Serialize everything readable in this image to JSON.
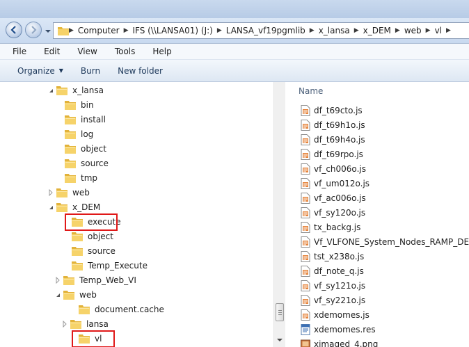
{
  "window": {
    "address": {
      "crumbs": [
        "Computer",
        "IFS (\\\\LANSA01) (J:)",
        "LANSA_vf19pgmlib",
        "x_lansa",
        "x_DEM",
        "web",
        "vl"
      ]
    }
  },
  "menu": {
    "items": [
      "File",
      "Edit",
      "View",
      "Tools",
      "Help"
    ]
  },
  "commands": {
    "organize": "Organize",
    "burn": "Burn",
    "new_folder": "New folder"
  },
  "tree": {
    "items": [
      {
        "label": "x_lansa"
      },
      {
        "label": "bin"
      },
      {
        "label": "install"
      },
      {
        "label": "log"
      },
      {
        "label": "object"
      },
      {
        "label": "source"
      },
      {
        "label": "tmp"
      },
      {
        "label": "web"
      },
      {
        "label": "x_DEM"
      },
      {
        "label": "execute"
      },
      {
        "label": "object"
      },
      {
        "label": "source"
      },
      {
        "label": "Temp_Execute"
      },
      {
        "label": "Temp_Web_VI"
      },
      {
        "label": "web"
      },
      {
        "label": "document.cache"
      },
      {
        "label": "lansa"
      },
      {
        "label": "vl"
      }
    ]
  },
  "filelist": {
    "column_header": "Name",
    "files": [
      {
        "name": "df_t69cto.js",
        "icon": "js-file-icon"
      },
      {
        "name": "df_t69h1o.js",
        "icon": "js-file-icon"
      },
      {
        "name": "df_t69h4o.js",
        "icon": "js-file-icon"
      },
      {
        "name": "df_t69rpo.js",
        "icon": "js-file-icon"
      },
      {
        "name": "vf_ch006o.js",
        "icon": "js-file-icon"
      },
      {
        "name": "vf_um012o.js",
        "icon": "js-file-icon"
      },
      {
        "name": "vf_ac006o.js",
        "icon": "js-file-icon"
      },
      {
        "name": "vf_sy120o.js",
        "icon": "js-file-icon"
      },
      {
        "name": "tx_backg.js",
        "icon": "js-file-icon"
      },
      {
        "name": "Vf_VLFONE_System_Nodes_RAMP_DEFAULT",
        "icon": "js-file-icon"
      },
      {
        "name": "tst_x238o.js",
        "icon": "js-file-icon"
      },
      {
        "name": "df_note_q.js",
        "icon": "js-file-icon"
      },
      {
        "name": "vf_sy121o.js",
        "icon": "js-file-icon"
      },
      {
        "name": "vf_sy221o.js",
        "icon": "js-file-icon"
      },
      {
        "name": "xdemomes.js",
        "icon": "js-file-icon"
      },
      {
        "name": "xdemomes.res",
        "icon": "res-file-icon"
      },
      {
        "name": "ximaged_4.png",
        "icon": "image-file-icon"
      }
    ]
  },
  "colors": {
    "highlight": "#e01818",
    "folder": "#f3c64b"
  }
}
